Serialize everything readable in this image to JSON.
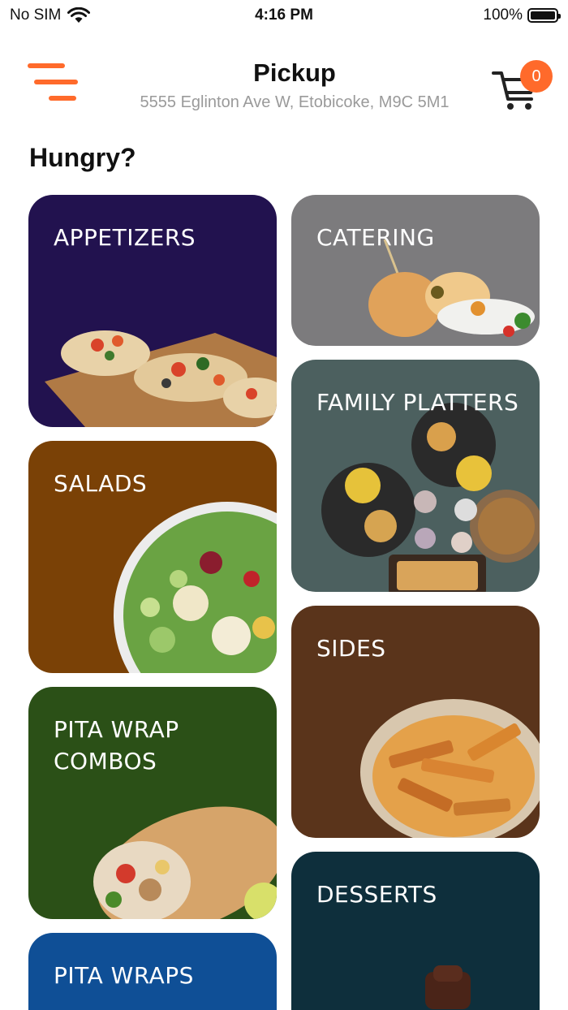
{
  "status_bar": {
    "carrier": "No SIM",
    "time": "4:16 PM",
    "battery": "100%"
  },
  "header": {
    "title": "Pickup",
    "address": "5555 Eglinton Ave W, Etobicoke, M9C 5M1",
    "cart_count": "0"
  },
  "section_title": "Hungry?",
  "categories": {
    "appetizers": {
      "label": "APPETIZERS",
      "color": "#22124f"
    },
    "catering": {
      "label": "CATERING",
      "color": "#7c7b7d"
    },
    "family_platters": {
      "label": "FAMILY PLATTERS",
      "color": "#4c605f"
    },
    "salads": {
      "label": "SALADS",
      "color": "#7a4106"
    },
    "sides": {
      "label": "SIDES",
      "color": "#5a341b"
    },
    "pita_wrap_combos": {
      "label": "PITA WRAP COMBOS",
      "color": "#2b5017"
    },
    "desserts": {
      "label": "DESSERTS",
      "color": "#0e2f3c"
    },
    "pita_wraps": {
      "label": "PITA WRAPS",
      "color": "#0f4f96"
    }
  },
  "accent_color": "#ff6a2b"
}
